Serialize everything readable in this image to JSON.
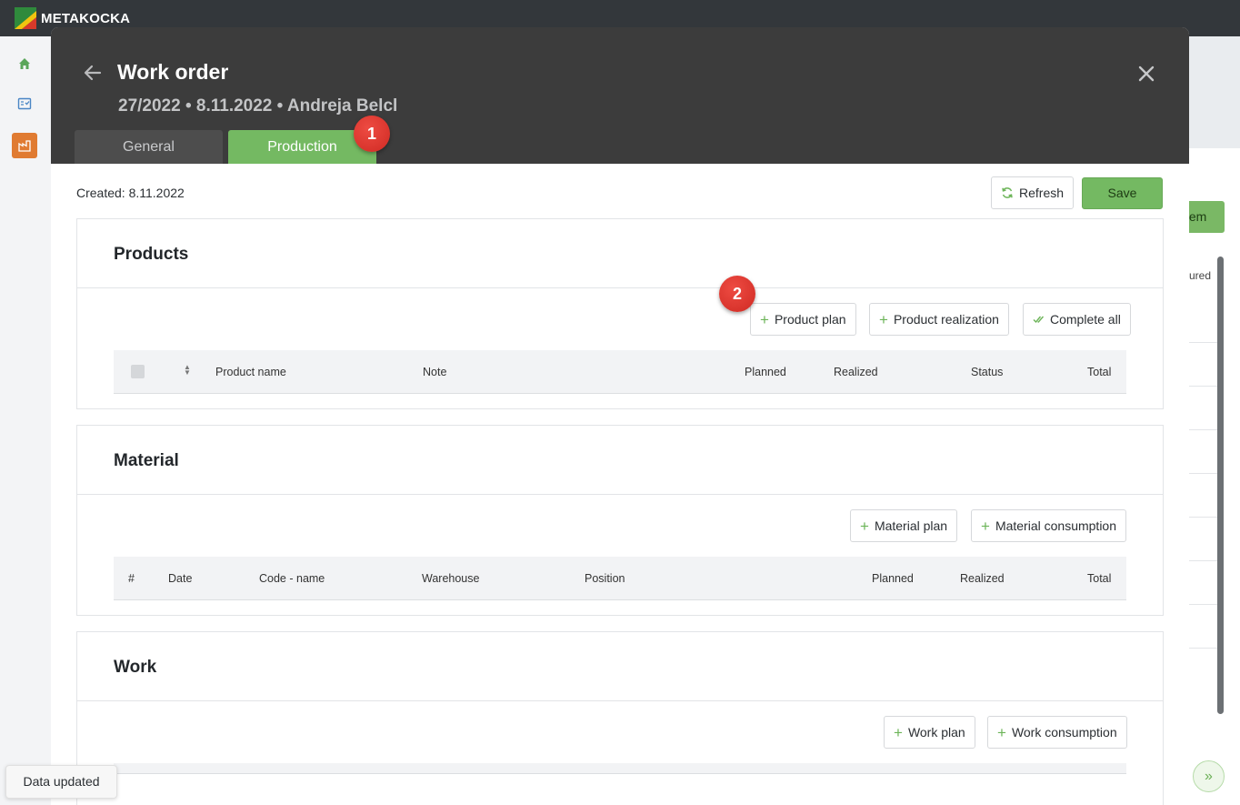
{
  "app": {
    "name": "METAKOCKA"
  },
  "background": {
    "action_button_fragment": "tem",
    "column_fragment": "ured"
  },
  "modal": {
    "title": "Work order",
    "subtitle": "27/2022 • 8.11.2022 • Andreja Belcl",
    "tabs": [
      {
        "label": "General",
        "active": false
      },
      {
        "label": "Production",
        "active": true
      }
    ],
    "markers": [
      "1",
      "2"
    ],
    "created": "Created: 8.11.2022",
    "refresh_label": "Refresh",
    "save_label": "Save"
  },
  "products": {
    "title": "Products",
    "buttons": [
      "Product plan",
      "Product realization",
      "Complete all"
    ],
    "columns": [
      "Product name",
      "Note",
      "Planned",
      "Realized",
      "Status",
      "Total"
    ]
  },
  "material": {
    "title": "Material",
    "buttons": [
      "Material plan",
      "Material consumption"
    ],
    "columns": [
      "#",
      "Date",
      "Code - name",
      "Warehouse",
      "Position",
      "Planned",
      "Realized",
      "Total"
    ]
  },
  "work": {
    "title": "Work",
    "buttons": [
      "Work plan",
      "Work consumption"
    ]
  },
  "toast": {
    "message": "Data updated"
  },
  "colors": {
    "accent": "#74b962",
    "header": "#3c3c3c",
    "marker": "#d9342c"
  }
}
